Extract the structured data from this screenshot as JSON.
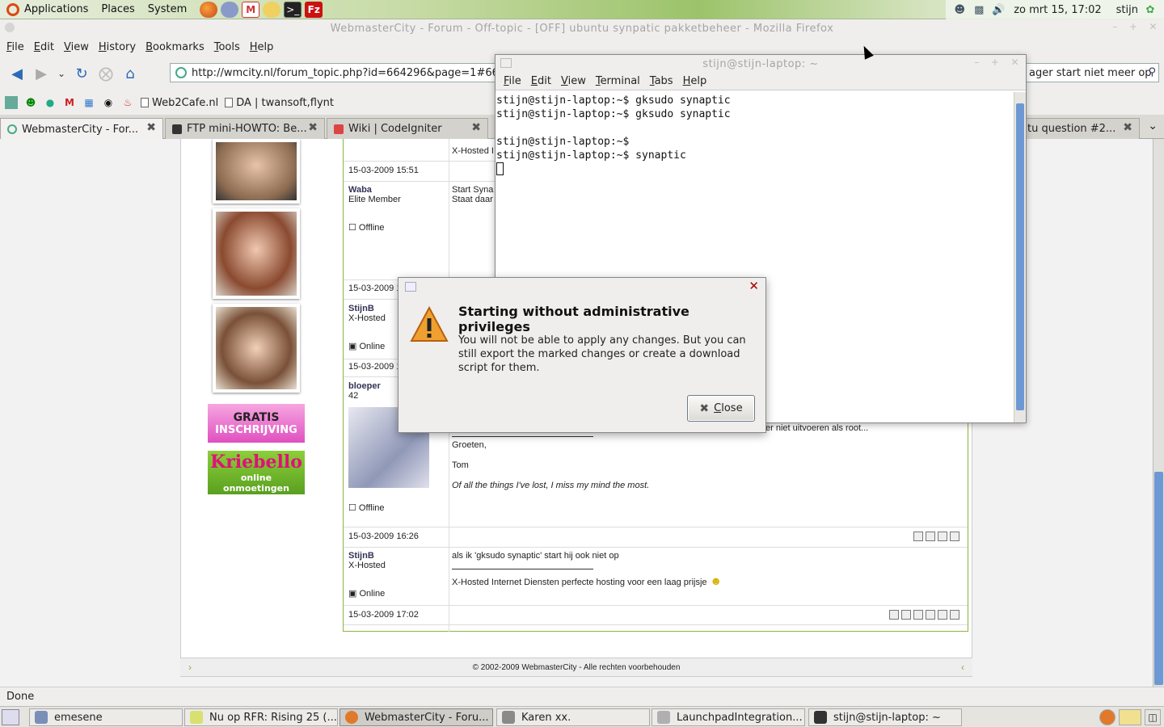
{
  "top_panel": {
    "menus": [
      "Applications",
      "Places",
      "System"
    ],
    "launchers": [
      "firefox-icon",
      "pidgin-icon",
      "gmail-icon",
      "gnome-do-icon",
      "terminal-icon",
      "filezilla-icon"
    ],
    "clock": "zo mrt 15, 17:02",
    "user": "stijn"
  },
  "firefox": {
    "title": "WebmasterCity - Forum - Off-topic - [OFF] ubuntu synpatic pakketbeheer - Mozilla Firefox",
    "menus": [
      "File",
      "Edit",
      "View",
      "History",
      "Bookmarks",
      "Tools",
      "Help"
    ],
    "url": "http://wmcity.nl/forum_topic.php?id=664296&page=1#66",
    "search_value": "ager start niet meer op",
    "bookmarks": [
      "Web2Cafe.nl",
      "DA | twansoft,flynt"
    ],
    "tabs": [
      {
        "label": "WebmasterCity - For..."
      },
      {
        "label": "FTP mini-HOWTO: Be..."
      },
      {
        "label": "Wiki | CodeIgniter"
      },
      {
        "label": "tu question #2..."
      }
    ],
    "status": "Done"
  },
  "forum": {
    "posts": [
      {
        "top_text": "X-Hosted I",
        "date": "15-03-2009 15:51"
      },
      {
        "user": "Waba",
        "rank": "Elite Member",
        "status": "Offline",
        "body1": "Start Syna",
        "body2": "Staat daar",
        "date": "15-03-2009 1"
      },
      {
        "user": "StijnB",
        "rank": "X-Hosted",
        "status": "Online",
        "date": "15-03-2009 1"
      },
      {
        "user": "bloeper",
        "rank": "42",
        "status": "Offline",
        "body1": "er niet uitvoeren als root...",
        "greeting": "Groeten,",
        "name": "Tom",
        "quote": "Of all the things I've lost, I miss my mind the most.",
        "date": "15-03-2009 16:26"
      },
      {
        "user": "StijnB",
        "rank": "X-Hosted",
        "status": "Online",
        "body1": "als ik 'gksudo synaptic' start hij ook niet op",
        "sig": "X-Hosted Internet Diensten perfecte hosting voor een laag prijsje",
        "date": "15-03-2009 17:02"
      }
    ],
    "ads": {
      "gratis_line1": "GRATIS",
      "gratis_line2": "INSCHRIJVING",
      "kriebello_line1": "Kriebello",
      "kriebello_line2": "online onmoetingen"
    },
    "footer": "© 2002-2009 WebmasterCity - Alle rechten voorbehouden"
  },
  "terminal": {
    "title": "stijn@stijn-laptop: ~",
    "menus": [
      "File",
      "Edit",
      "View",
      "Terminal",
      "Tabs",
      "Help"
    ],
    "lines": [
      "stijn@stijn-laptop:~$ gksudo synaptic",
      "stijn@stijn-laptop:~$ gksudo synaptic",
      "",
      "stijn@stijn-laptop:~$",
      "stijn@stijn-laptop:~$ synaptic"
    ]
  },
  "dialog": {
    "title": "Starting without administrative privileges",
    "message": "You will not be able to apply any changes. But you can still export the marked changes or create a download script for them.",
    "button": "Close"
  },
  "taskbar": {
    "items": [
      {
        "label": "emesene",
        "color": "#7a8fb8"
      },
      {
        "label": "Nu op RFR: Rising 25 (...",
        "color": "#d9e070"
      },
      {
        "label": "WebmasterCity - Foru...",
        "color": "#e07a2a"
      },
      {
        "label": "Karen xx.",
        "color": "#8a8a8a"
      },
      {
        "label": "LaunchpadIntegration...",
        "color": "#b0b0b0"
      },
      {
        "label": "stijn@stijn-laptop: ~",
        "color": "#333333"
      }
    ]
  }
}
